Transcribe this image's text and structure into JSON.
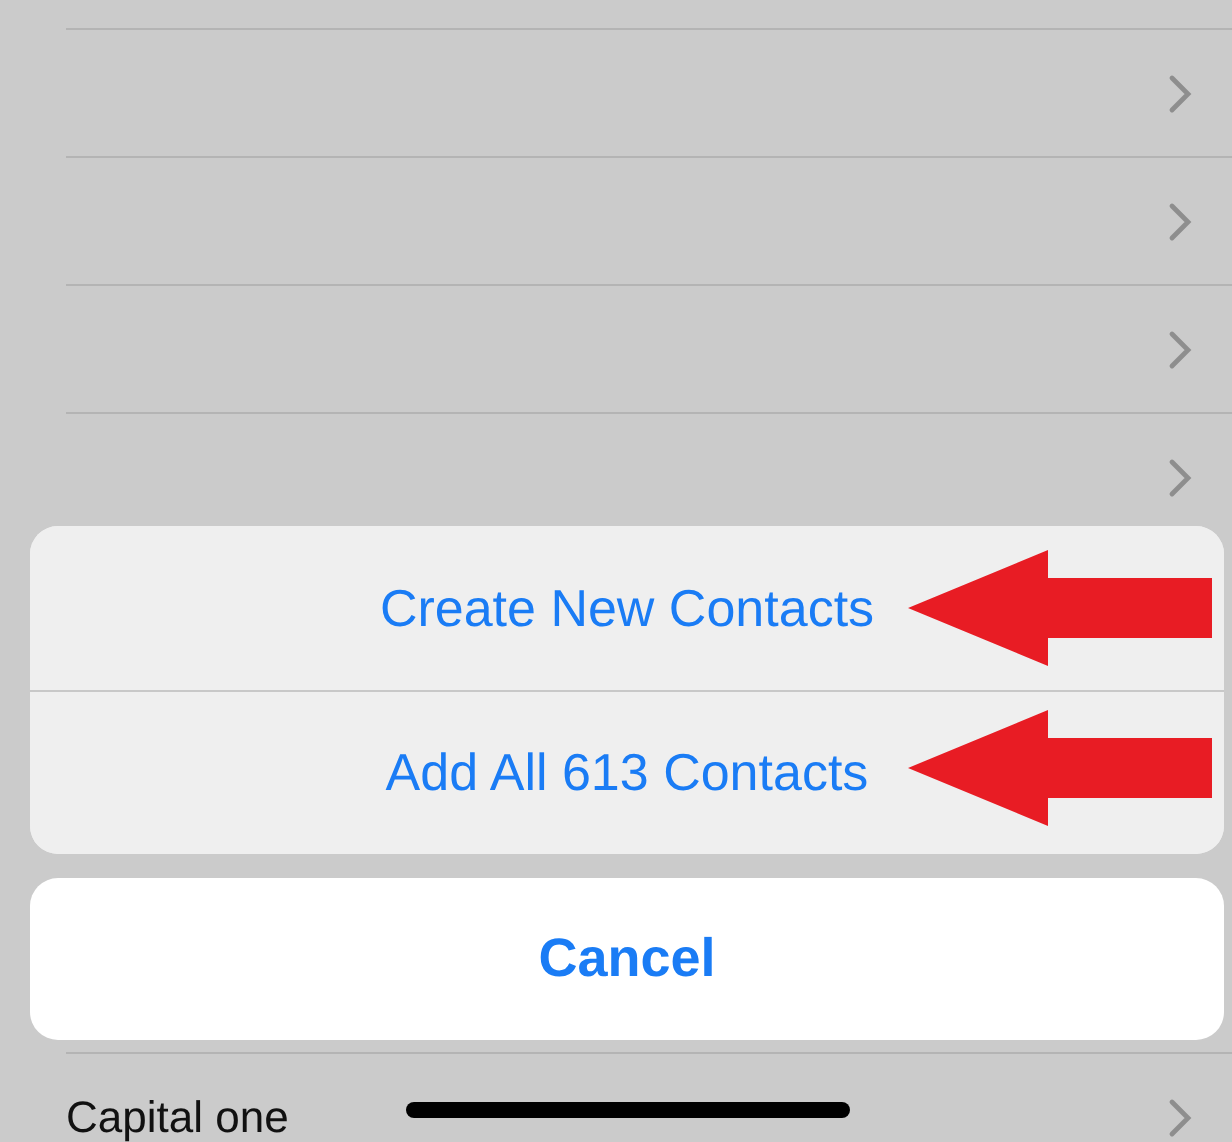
{
  "list": {
    "rows": [
      {
        "label": ""
      },
      {
        "label": ""
      },
      {
        "label": ""
      },
      {
        "label": ""
      }
    ],
    "bottom_row": {
      "label": "Capital one"
    }
  },
  "action_sheet": {
    "actions": [
      {
        "label": "Create New Contacts",
        "highlighted": true
      },
      {
        "label": "Add All 613 Contacts",
        "highlighted": true
      }
    ],
    "cancel": "Cancel"
  }
}
